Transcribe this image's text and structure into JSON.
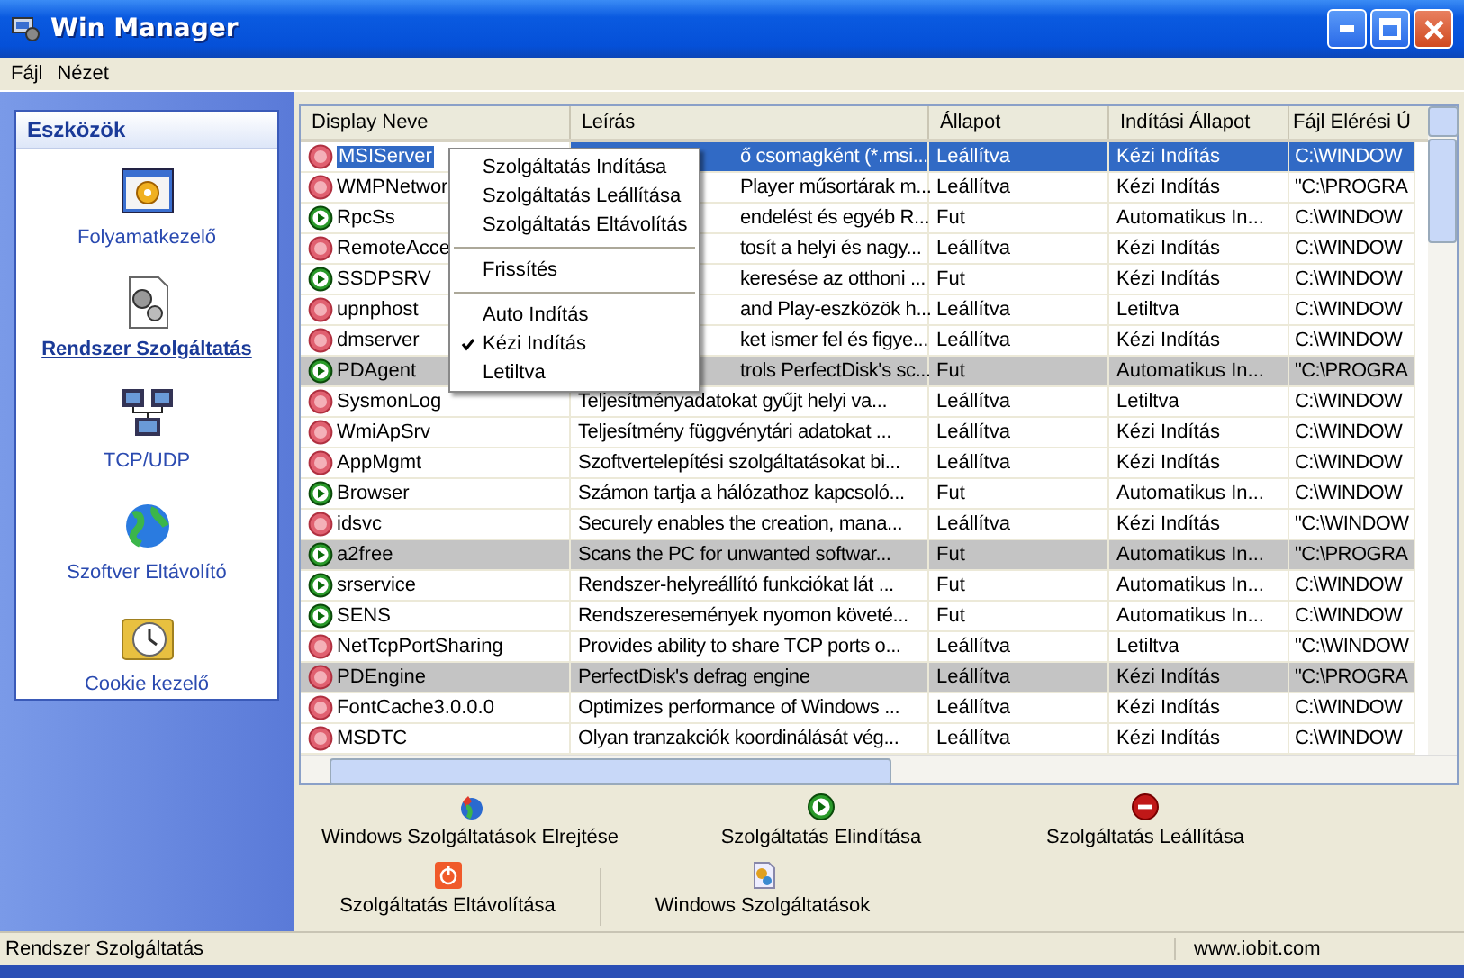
{
  "window": {
    "title": "Win Manager"
  },
  "menu_bar": [
    "Fájl",
    "Nézet"
  ],
  "sidebar": {
    "title": "Eszközök",
    "items": [
      {
        "label": "Folyamatkezelő",
        "selected": false
      },
      {
        "label": "Rendszer Szolgáltatás",
        "selected": true
      },
      {
        "label": "TCP/UDP",
        "selected": false
      },
      {
        "label": "Szoftver Eltávolító",
        "selected": false
      },
      {
        "label": "Cookie kezelő",
        "selected": false
      }
    ]
  },
  "table": {
    "columns": [
      "Display Neve",
      "Leírás",
      "Állapot",
      "Indítási Állapot",
      "Fájl Elérési Ú"
    ],
    "rows": [
      {
        "name": "MSIServer",
        "description": "ő csomagként (*.msi...",
        "status": "Leállítva",
        "startup": "Kézi Indítás",
        "path": "C:\\WINDOW",
        "running": false,
        "selected": true,
        "marked": false,
        "partly_hidden": true
      },
      {
        "name": "WMPNetwor",
        "description": "Player műsortárak m...",
        "status": "Leállítva",
        "startup": "Kézi Indítás",
        "path": "\"C:\\PROGRA",
        "running": false,
        "selected": false,
        "marked": false,
        "partly_hidden": true
      },
      {
        "name": "RpcSs",
        "description": "endelést és egyéb R...",
        "status": "Fut",
        "startup": "Automatikus In...",
        "path": "C:\\WINDOW",
        "running": true,
        "selected": false,
        "marked": false,
        "partly_hidden": true
      },
      {
        "name": "RemoteAcce",
        "description": "tosít a helyi és nagy...",
        "status": "Leállítva",
        "startup": "Kézi Indítás",
        "path": "C:\\WINDOW",
        "running": false,
        "selected": false,
        "marked": false,
        "partly_hidden": true
      },
      {
        "name": "SSDPSRV",
        "description": "keresése az otthoni ...",
        "status": "Fut",
        "startup": "Kézi Indítás",
        "path": "C:\\WINDOW",
        "running": true,
        "selected": false,
        "marked": false,
        "partly_hidden": true
      },
      {
        "name": "upnphost",
        "description": "and Play-eszközök h...",
        "status": "Leállítva",
        "startup": "Letiltva",
        "path": "C:\\WINDOW",
        "running": false,
        "selected": false,
        "marked": false,
        "partly_hidden": true
      },
      {
        "name": "dmserver",
        "description": "ket ismer fel és figye...",
        "status": "Leállítva",
        "startup": "Kézi Indítás",
        "path": "C:\\WINDOW",
        "running": false,
        "selected": false,
        "marked": false,
        "partly_hidden": true
      },
      {
        "name": "PDAgent",
        "description": "trols PerfectDisk's sc...",
        "status": "Fut",
        "startup": "Automatikus In...",
        "path": "\"C:\\PROGRA",
        "running": true,
        "selected": false,
        "marked": true,
        "partly_hidden": true
      },
      {
        "name": "SysmonLog",
        "description": "Teljesítményadatokat gyűjt helyi va...",
        "status": "Leállítva",
        "startup": "Letiltva",
        "path": "C:\\WINDOW",
        "running": false,
        "selected": false,
        "marked": false,
        "partly_hidden": false
      },
      {
        "name": "WmiApSrv",
        "description": "Teljesítmény függvénytári adatokat ...",
        "status": "Leállítva",
        "startup": "Kézi Indítás",
        "path": "C:\\WINDOW",
        "running": false,
        "selected": false,
        "marked": false,
        "partly_hidden": false
      },
      {
        "name": "AppMgmt",
        "description": "Szoftvertelepítési szolgáltatásokat bi...",
        "status": "Leállítva",
        "startup": "Kézi Indítás",
        "path": "C:\\WINDOW",
        "running": false,
        "selected": false,
        "marked": false,
        "partly_hidden": false
      },
      {
        "name": "Browser",
        "description": "Számon tartja a hálózathoz kapcsoló...",
        "status": "Fut",
        "startup": "Automatikus In...",
        "path": "C:\\WINDOW",
        "running": true,
        "selected": false,
        "marked": false,
        "partly_hidden": false
      },
      {
        "name": "idsvc",
        "description": "Securely enables the creation, mana...",
        "status": "Leállítva",
        "startup": "Kézi Indítás",
        "path": "\"C:\\WINDOW",
        "running": false,
        "selected": false,
        "marked": false,
        "partly_hidden": false
      },
      {
        "name": "a2free",
        "description": "Scans the PC for unwanted softwar...",
        "status": "Fut",
        "startup": "Automatikus In...",
        "path": "\"C:\\PROGRA",
        "running": true,
        "selected": false,
        "marked": true,
        "partly_hidden": false
      },
      {
        "name": "srservice",
        "description": "Rendszer-helyreállító funkciókat lát ...",
        "status": "Fut",
        "startup": "Automatikus In...",
        "path": "C:\\WINDOW",
        "running": true,
        "selected": false,
        "marked": false,
        "partly_hidden": false
      },
      {
        "name": "SENS",
        "description": "Rendszeresemények nyomon követé...",
        "status": "Fut",
        "startup": "Automatikus In...",
        "path": "C:\\WINDOW",
        "running": true,
        "selected": false,
        "marked": false,
        "partly_hidden": false
      },
      {
        "name": "NetTcpPortSharing",
        "description": "Provides ability to share TCP ports o...",
        "status": "Leállítva",
        "startup": "Letiltva",
        "path": "\"C:\\WINDOW",
        "running": false,
        "selected": false,
        "marked": false,
        "partly_hidden": false
      },
      {
        "name": "PDEngine",
        "description": "PerfectDisk's defrag engine",
        "status": "Leállítva",
        "startup": "Kézi Indítás",
        "path": "\"C:\\PROGRA",
        "running": false,
        "selected": false,
        "marked": true,
        "partly_hidden": false
      },
      {
        "name": "FontCache3.0.0.0",
        "description": "Optimizes performance of Windows ...",
        "status": "Leállítva",
        "startup": "Kézi Indítás",
        "path": "C:\\WINDOW",
        "running": false,
        "selected": false,
        "marked": false,
        "partly_hidden": false
      },
      {
        "name": "MSDTC",
        "description": "Olyan tranzakciók koordinálását vég...",
        "status": "Leállítva",
        "startup": "Kézi Indítás",
        "path": "C:\\WINDOW",
        "running": false,
        "selected": false,
        "marked": false,
        "partly_hidden": false
      }
    ]
  },
  "context_menu": [
    [
      {
        "label": "Szolgáltatás Indítása",
        "checked": false
      },
      {
        "label": "Szolgáltatás Leállítása",
        "checked": false
      },
      {
        "label": "Szolgáltatás Eltávolítás",
        "checked": false
      }
    ],
    [
      {
        "label": "Frissítés",
        "checked": false
      }
    ],
    [
      {
        "label": "Auto Indítás",
        "checked": false
      },
      {
        "label": "Kézi Indítás",
        "checked": true
      },
      {
        "label": "Letiltva",
        "checked": false
      }
    ]
  ],
  "actions": [
    [
      {
        "label": "Windows Szolgáltatások Elrejtése"
      },
      {
        "label": "Szolgáltatás Elindítása"
      },
      {
        "label": "Szolgáltatás Leállítása"
      }
    ],
    [
      {
        "label": "Szolgáltatás Eltávolítása"
      },
      {
        "label": "Windows Szolgáltatások"
      }
    ]
  ],
  "status_bar": {
    "left": "Rendszer Szolgáltatás",
    "right": "www.iobit.com"
  }
}
